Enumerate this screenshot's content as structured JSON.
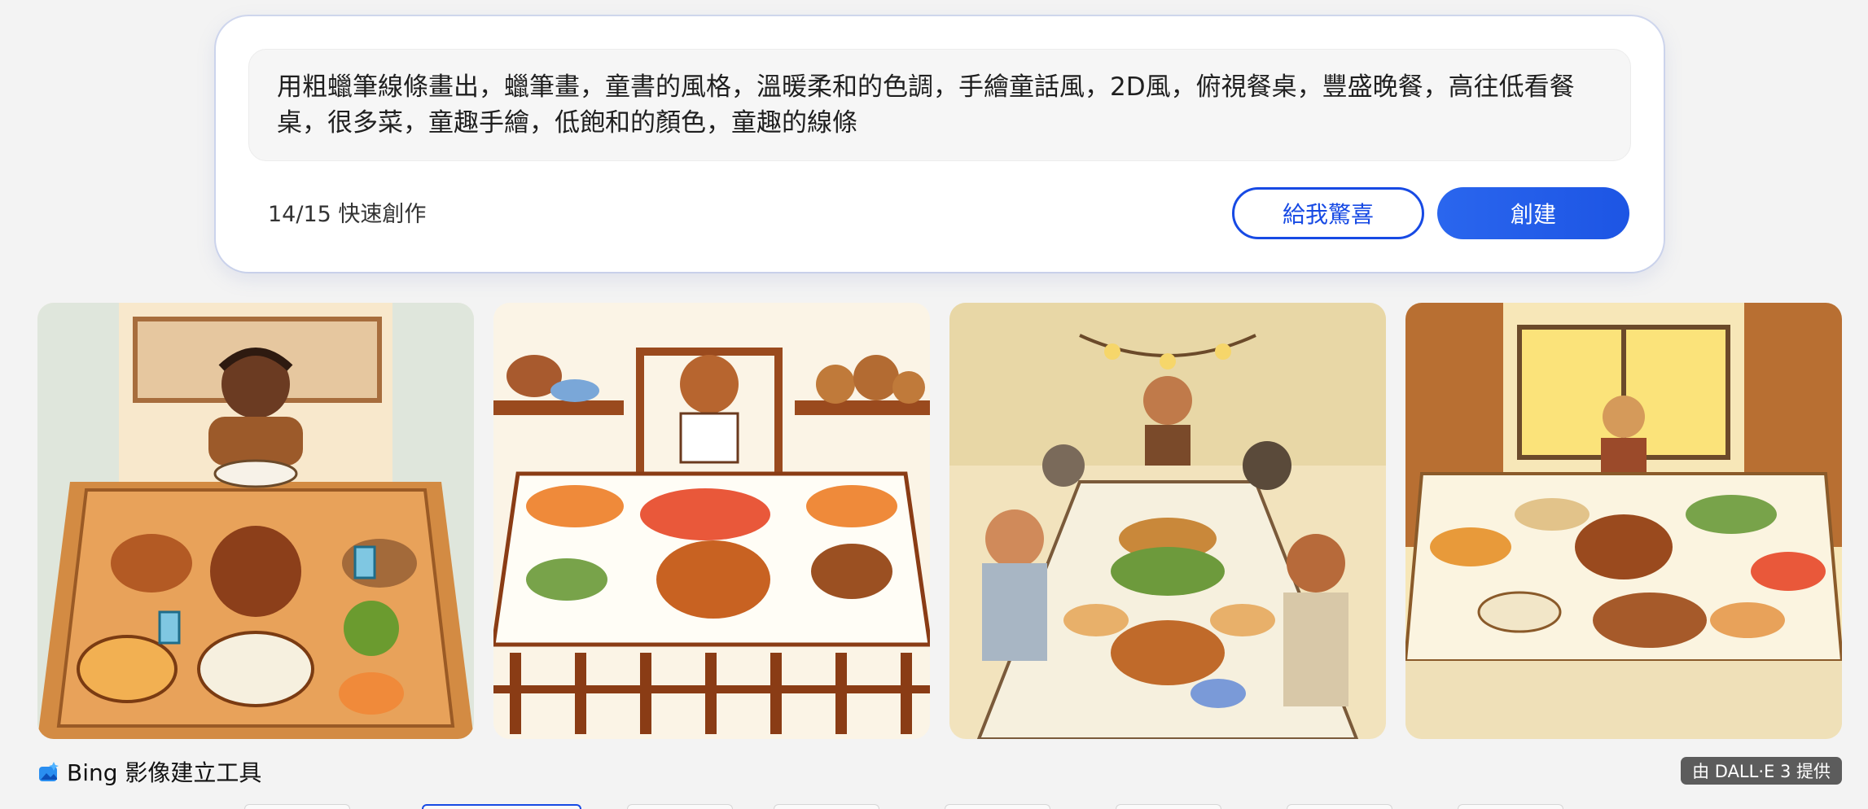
{
  "prompt": {
    "text": "用粗蠟筆線條畫出，蠟筆畫，童書的風格，溫暖柔和的色調，手繪童話風，2D風，俯視餐桌，豐盛晚餐，高往低看餐桌，很多菜，童趣手繪，低飽和的顏色，童趣的線條"
  },
  "quota": {
    "label": "14/15 快速創作"
  },
  "buttons": {
    "surprise_label": "給我驚喜",
    "create_label": "創建"
  },
  "images": [
    {
      "name": "generated-image-1"
    },
    {
      "name": "generated-image-2"
    },
    {
      "name": "generated-image-3"
    },
    {
      "name": "generated-image-4"
    }
  ],
  "footer": {
    "brand_label": "Bing 影像建立工具",
    "badge_label": "由 DALL·E 3 提供"
  },
  "colors": {
    "accent": "#174ae4",
    "background": "#f3f3f3"
  }
}
